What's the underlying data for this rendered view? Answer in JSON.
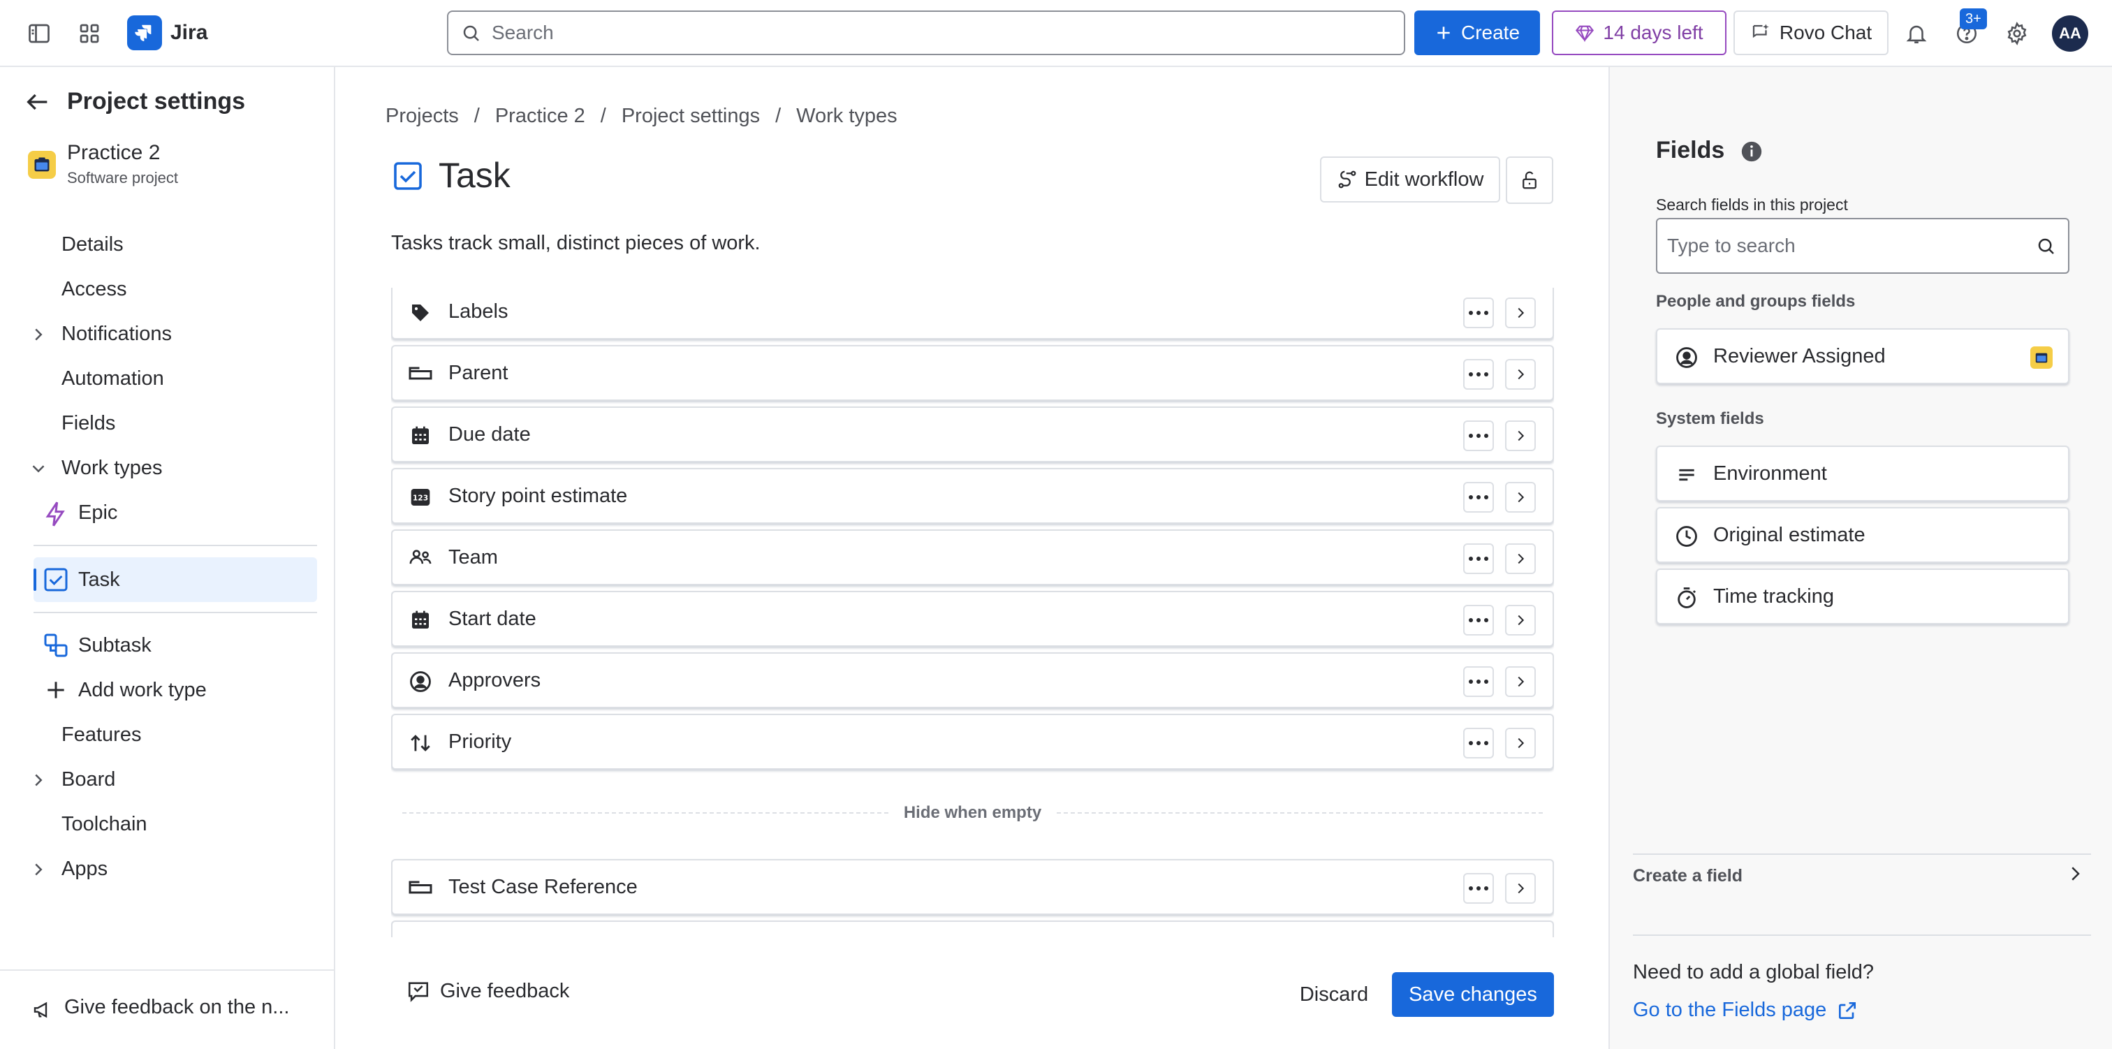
{
  "topbar": {
    "app_name": "Jira",
    "search_placeholder": "Search",
    "create_label": "Create",
    "trial_label": "14 days left",
    "rovo_label": "Rovo Chat",
    "help_badge": "3+",
    "avatar_initials": "AA"
  },
  "sidebar": {
    "title": "Project settings",
    "project_name": "Practice 2",
    "project_type": "Software project",
    "items": {
      "details": "Details",
      "access": "Access",
      "notifications": "Notifications",
      "automation": "Automation",
      "fields": "Fields",
      "work_types": "Work types",
      "epic": "Epic",
      "task": "Task",
      "subtask": "Subtask",
      "add_work_type": "Add work type",
      "features": "Features",
      "board": "Board",
      "toolchain": "Toolchain",
      "apps": "Apps"
    },
    "feedback": "Give feedback on the n..."
  },
  "breadcrumbs": [
    "Projects",
    "Practice 2",
    "Project settings",
    "Work types"
  ],
  "main": {
    "title": "Task",
    "edit_workflow": "Edit workflow",
    "description": "Tasks track small, distinct pieces of work.",
    "fields": [
      {
        "label": "Labels",
        "icon": "tag-icon"
      },
      {
        "label": "Parent",
        "icon": "parent-icon"
      },
      {
        "label": "Due date",
        "icon": "calendar-icon"
      },
      {
        "label": "Story point estimate",
        "icon": "number-icon"
      },
      {
        "label": "Team",
        "icon": "team-icon"
      },
      {
        "label": "Start date",
        "icon": "calendar-icon"
      },
      {
        "label": "Approvers",
        "icon": "person-circle-icon"
      },
      {
        "label": "Priority",
        "icon": "priority-icon"
      }
    ],
    "hide_when_empty": "Hide when empty",
    "hidden_fields": [
      {
        "label": "Test Case Reference",
        "icon": "parent-icon"
      }
    ],
    "give_feedback": "Give feedback",
    "discard": "Discard",
    "save": "Save changes"
  },
  "right_panel": {
    "title": "Fields",
    "search_label": "Search fields in this project",
    "search_placeholder": "Type to search",
    "people_group": "People and groups fields",
    "people_fields": [
      "Reviewer Assigned"
    ],
    "system_group": "System fields",
    "system_fields": [
      "Environment",
      "Original estimate",
      "Time tracking"
    ],
    "create_field": "Create a field",
    "need_global": "Need to add a global field?",
    "fields_page_link": "Go to the Fields page"
  },
  "colors": {
    "brand_blue": "#1868db",
    "trial_purple": "#803fa5",
    "selected_bg": "#e9f2fe",
    "project_icon": "#f5cd47"
  }
}
